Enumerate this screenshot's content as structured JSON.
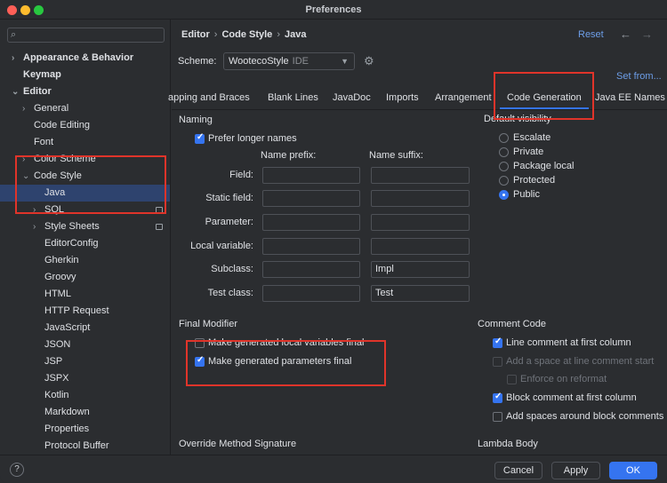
{
  "window": {
    "title": "Preferences"
  },
  "search": {
    "placeholder": ""
  },
  "sidebar": {
    "items": [
      {
        "label": "Appearance & Behavior",
        "arrow": "›"
      },
      {
        "label": "Keymap",
        "arrow": ""
      },
      {
        "label": "Editor",
        "arrow": "⌄"
      },
      {
        "label": "General",
        "arrow": "›"
      },
      {
        "label": "Code Editing",
        "arrow": ""
      },
      {
        "label": "Font",
        "arrow": ""
      },
      {
        "label": "Color Scheme",
        "arrow": "›"
      },
      {
        "label": "Code Style",
        "arrow": "⌄"
      },
      {
        "label": "Java",
        "arrow": ""
      },
      {
        "label": "SQL",
        "arrow": "›"
      },
      {
        "label": "Style Sheets",
        "arrow": "›"
      },
      {
        "label": "EditorConfig",
        "arrow": ""
      },
      {
        "label": "Gherkin",
        "arrow": ""
      },
      {
        "label": "Groovy",
        "arrow": ""
      },
      {
        "label": "HTML",
        "arrow": ""
      },
      {
        "label": "HTTP Request",
        "arrow": ""
      },
      {
        "label": "JavaScript",
        "arrow": ""
      },
      {
        "label": "JSON",
        "arrow": ""
      },
      {
        "label": "JSP",
        "arrow": ""
      },
      {
        "label": "JSPX",
        "arrow": ""
      },
      {
        "label": "Kotlin",
        "arrow": ""
      },
      {
        "label": "Markdown",
        "arrow": ""
      },
      {
        "label": "Properties",
        "arrow": ""
      },
      {
        "label": "Protocol Buffer",
        "arrow": ""
      }
    ]
  },
  "breadcrumb": {
    "part1": "Editor",
    "part2": "Code Style",
    "part3": "Java",
    "sep": "›"
  },
  "header": {
    "reset": "Reset",
    "back_icon": "←",
    "forward_icon": "→"
  },
  "scheme": {
    "label": "Scheme:",
    "value": "WootecoStyle",
    "tag": "IDE",
    "set_from": "Set from..."
  },
  "tabs": [
    "apping and Braces",
    "Blank Lines",
    "JavaDoc",
    "Imports",
    "Arrangement",
    "Code Generation",
    "Java EE Names"
  ],
  "naming": {
    "title": "Naming",
    "prefer_longer": {
      "label": "Prefer longer names",
      "checked": true
    },
    "prefix_header": "Name prefix:",
    "suffix_header": "Name suffix:",
    "rows": [
      {
        "label": "Field:",
        "prefix": "",
        "suffix": ""
      },
      {
        "label": "Static field:",
        "prefix": "",
        "suffix": ""
      },
      {
        "label": "Parameter:",
        "prefix": "",
        "suffix": ""
      },
      {
        "label": "Local variable:",
        "prefix": "",
        "suffix": ""
      },
      {
        "label": "Subclass:",
        "prefix": "",
        "suffix": "Impl"
      },
      {
        "label": "Test class:",
        "prefix": "",
        "suffix": "Test"
      }
    ]
  },
  "visibility": {
    "title": "Default visibility",
    "options": [
      "Escalate",
      "Private",
      "Package local",
      "Protected",
      "Public"
    ],
    "selected": "Public"
  },
  "final_modifier": {
    "title": "Final Modifier",
    "local_vars": {
      "label": "Make generated local variables final",
      "checked": false
    },
    "params": {
      "label": "Make generated parameters final",
      "checked": true
    }
  },
  "comment_code": {
    "title": "Comment Code",
    "line_first": {
      "label": "Line comment at first column",
      "checked": true
    },
    "add_space": {
      "label": "Add a space at line comment start",
      "checked": false
    },
    "enforce": {
      "label": "Enforce on reformat",
      "checked": false
    },
    "block_first": {
      "label": "Block comment at first column",
      "checked": true
    },
    "add_spaces_block": {
      "label": "Add spaces around block comments",
      "checked": false
    }
  },
  "override_section": {
    "title": "Override Method Signature"
  },
  "lambda_section": {
    "title": "Lambda Body"
  },
  "footer": {
    "help": "?",
    "cancel": "Cancel",
    "apply": "Apply",
    "ok": "OK"
  },
  "colors": {
    "accent": "#3574f0",
    "highlight": "#e0342a",
    "link": "#6d9ee8",
    "selection": "#2e436e"
  }
}
